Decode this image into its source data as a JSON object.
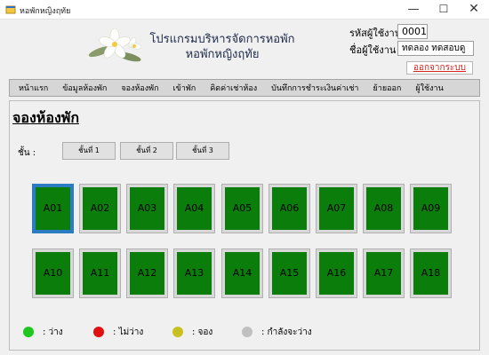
{
  "window": {
    "title": "หอพักหญิงฤทัย",
    "minimize": "—",
    "maximize": "☐",
    "close": "✕"
  },
  "header": {
    "program_title_line1": "โปรแกรมบริหารจัดการหอพัก",
    "program_title_line2": "หอพักหญิงฤทัย",
    "user_code_label": "รหัสผู้ใช้งาน",
    "user_code_value": "0001",
    "user_name_label": "ชื่อผู้ใช้งาน",
    "user_name_value": "ทดลอง  ทดสอบดู",
    "logout_label": "ออกจากระบบ"
  },
  "menu": [
    "หน้าแรก",
    "ข้อมูลห้องพัก",
    "จองห้องพัก",
    "เข้าพัก",
    "คิดค่าเช่าห้อง",
    "บันทึกการชำระเงินค่าเช่า",
    "ย้ายออก",
    "ผู้ใช้งาน"
  ],
  "page": {
    "title": "จองห้องพัก",
    "floor_label": "ชั้น   :",
    "floor_buttons": [
      "ชั้นที่ 1",
      "ชั้นที่ 2",
      "ชั้นที่ 3"
    ]
  },
  "rooms": {
    "row1": [
      "A01",
      "A02",
      "A03",
      "A04",
      "A05",
      "A06",
      "A07",
      "A08",
      "A09"
    ],
    "row2": [
      "A10",
      "A11",
      "A12",
      "A13",
      "A14",
      "A15",
      "A16",
      "A17",
      "A18"
    ],
    "selected": "A01",
    "status_color": "#0a7d0a"
  },
  "legend": [
    {
      "label": ":   ว่าง",
      "color": "#1ec81e"
    },
    {
      "label": ":   ไม่ว่าง",
      "color": "#e01010"
    },
    {
      "label": ":   จอง",
      "color": "#c8c020"
    },
    {
      "label": ":   กำลังจะว่าง",
      "color": "#c0c0c0"
    }
  ]
}
